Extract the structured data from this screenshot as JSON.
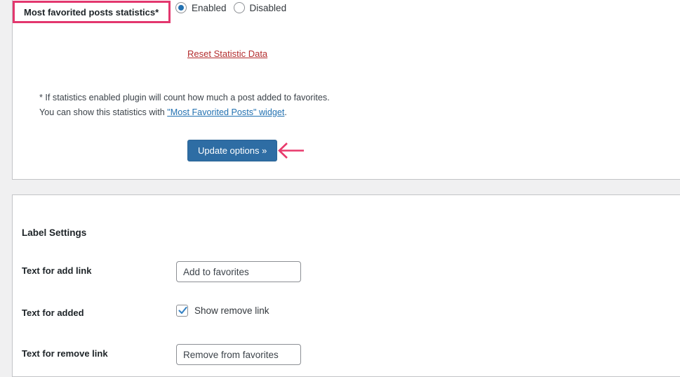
{
  "stats_panel": {
    "setting_label": "Most favorited posts statistics*",
    "radios": [
      {
        "label": "Enabled",
        "selected": true
      },
      {
        "label": "Disabled",
        "selected": false
      }
    ],
    "reset_link": "Reset Statistic Data",
    "note_line1": "* If statistics enabled plugin will count how much a post added to favorites.",
    "note_line2_prefix": "You can show this statistics with ",
    "note_line2_link": "\"Most Favorited Posts\" widget",
    "note_line2_suffix": ".",
    "submit_label": "Update options »"
  },
  "labels_panel": {
    "heading": "Label Settings",
    "fields": [
      {
        "label": "Text for add link",
        "value": "Add to favorites"
      },
      {
        "label": "Text for added",
        "checkbox_label": "Show remove link",
        "checked": true
      },
      {
        "label": "Text for remove link",
        "value": "Remove from favorites"
      }
    ]
  },
  "annotations": {
    "highlight_color": "#e3376e",
    "arrow_color": "#e8396b",
    "button_color": "#2e6da4",
    "link_color": "#2271b1",
    "reset_link_color": "#b32d2e"
  }
}
